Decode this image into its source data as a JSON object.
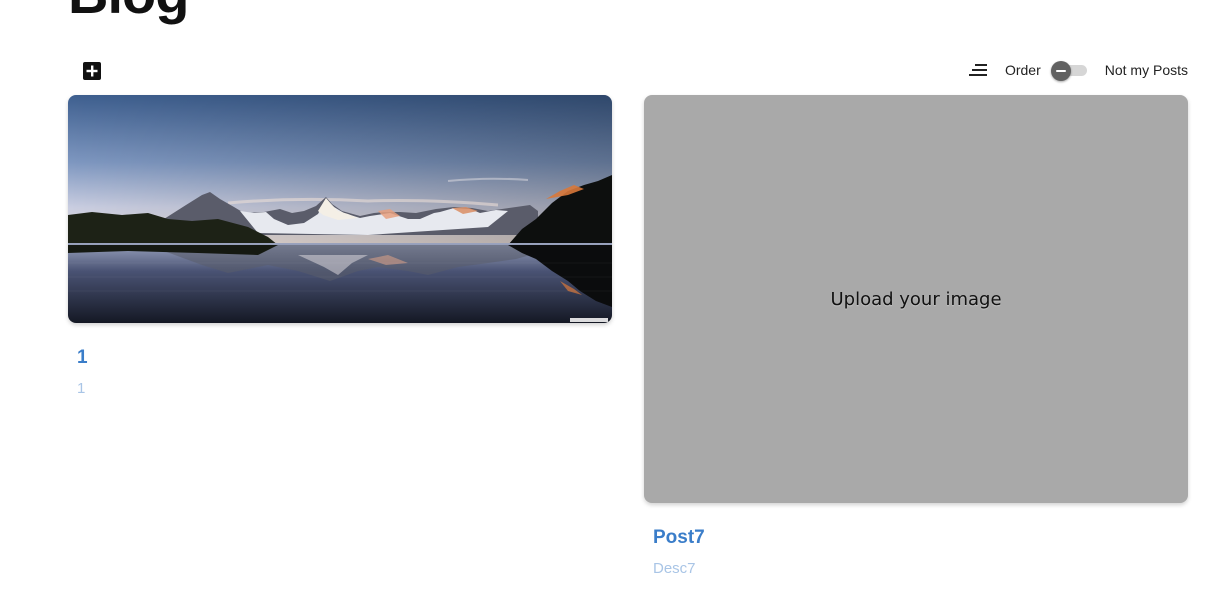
{
  "page": {
    "title": "Blog"
  },
  "toolbar": {
    "add_icon": "plus-square-icon",
    "sort_icon": "sort-lines-icon",
    "order_label": "Order",
    "not_my_posts_label": "Not my Posts",
    "toggle_on": false
  },
  "posts": [
    {
      "title": "1",
      "description": "1",
      "image": "mountain-lake-landscape"
    },
    {
      "title": "Post7",
      "description": "Desc7",
      "placeholder_text": "Upload your image"
    }
  ],
  "colors": {
    "title": "#3a7dc9",
    "description": "#a9c5e6",
    "placeholder_bg": "#a9a9a9"
  }
}
